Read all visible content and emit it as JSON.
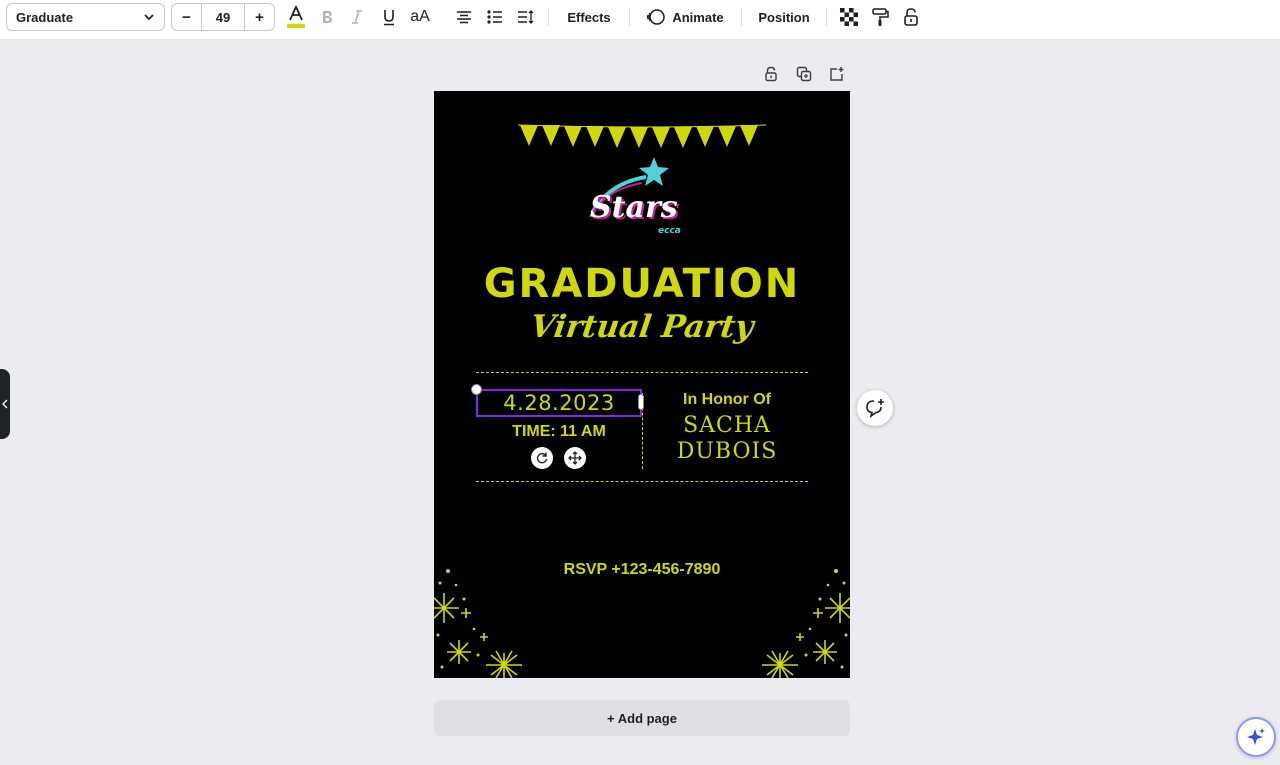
{
  "toolbar": {
    "font_name": "Graduate",
    "font_size": "49",
    "decrease_label": "−",
    "increase_label": "+",
    "case_label": "aA",
    "effects_label": "Effects",
    "animate_label": "Animate",
    "position_label": "Position",
    "text_color": "#cfd80a"
  },
  "poster": {
    "logo_text": "Stars",
    "logo_sub": "ecca",
    "title": "GRADUATION",
    "subtitle": "Virtual Party",
    "date": "4.28.2023",
    "time": "TIME: 11 AM",
    "honor": "In Honor Of",
    "name_first": "SACHA",
    "name_last": "DUBOIS",
    "rsvp": "RSVP +123-456-7890",
    "accent_color": "#cfd80a",
    "background_color": "#000000"
  },
  "canvas": {
    "add_page_label": "+ Add page",
    "selection_color": "#7d2ae8"
  },
  "icons": {
    "lock": "lock-icon",
    "duplicate": "duplicate-icon",
    "share": "share-icon",
    "comment": "comment-add-icon",
    "magic": "magic-sparkle-icon"
  }
}
